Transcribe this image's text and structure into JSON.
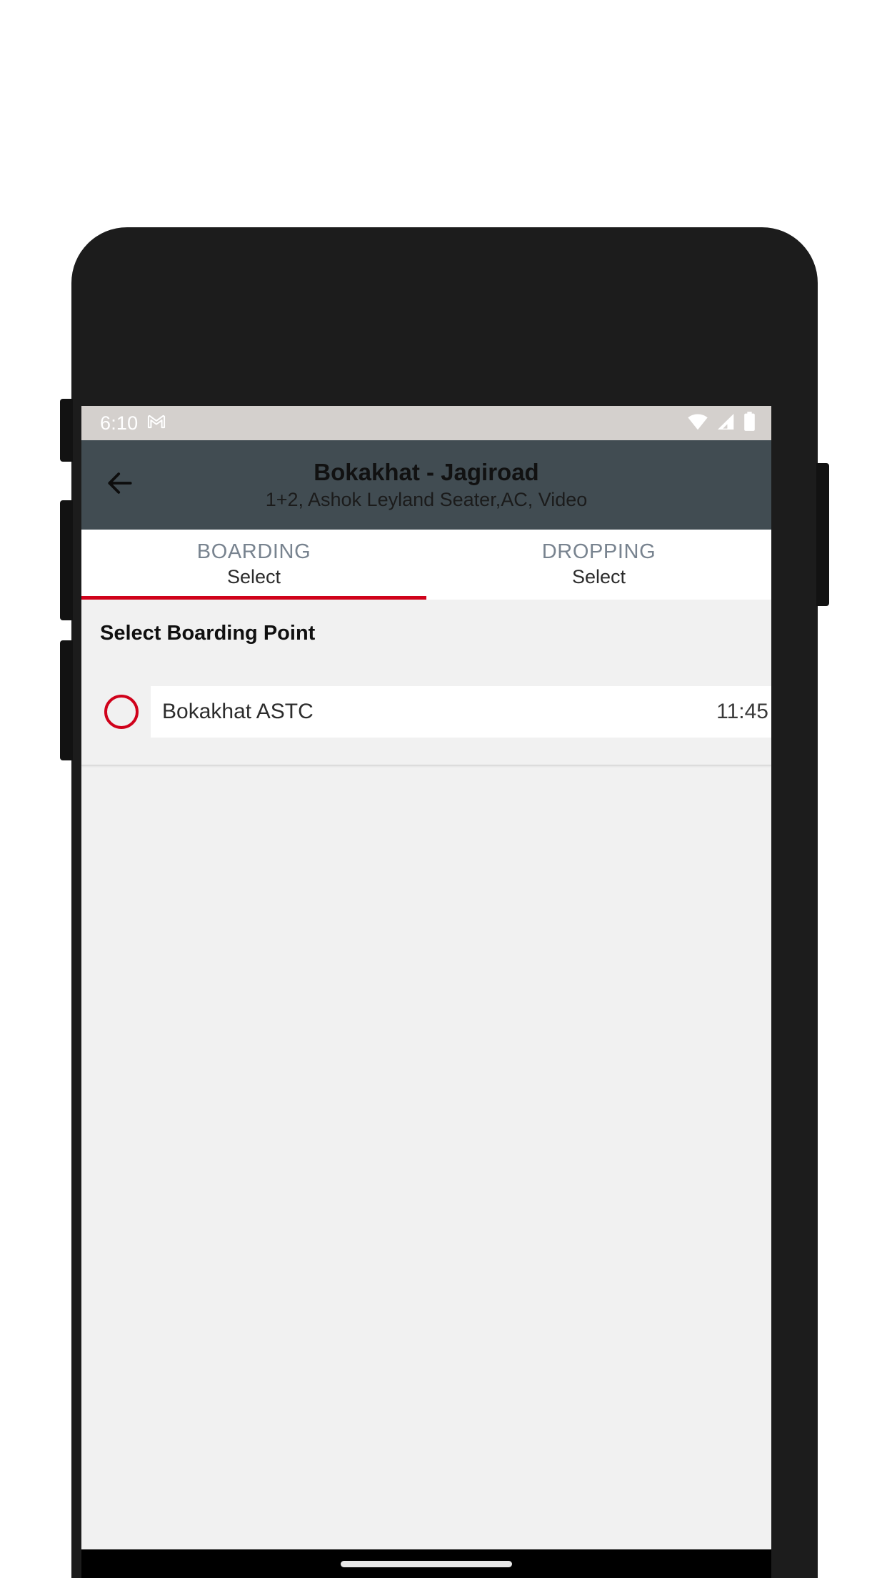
{
  "status_bar": {
    "time": "6:10",
    "notification_icon": "gmail-icon",
    "icons": [
      "wifi-icon",
      "cellular-signal-icon",
      "battery-icon"
    ]
  },
  "app_bar": {
    "back_icon": "back-arrow-icon",
    "title": "Bokakhat - Jagiroad",
    "subtitle": "1+2, Ashok Leyland Seater,AC, Video",
    "background_color": "#414c52"
  },
  "tabs": [
    {
      "label": "BOARDING",
      "value": "Select",
      "active": true
    },
    {
      "label": "DROPPING",
      "value": "Select",
      "active": false
    }
  ],
  "content": {
    "section_title": "Select Boarding Point",
    "points": [
      {
        "name": "Bokakhat ASTC",
        "time": "11:45",
        "selected": false
      }
    ]
  },
  "colors": {
    "accent": "#d0021b",
    "app_bar": "#414c52",
    "tab_label": "#78838f",
    "background": "#f1f1f1",
    "status_bar": "#d4d0cd"
  },
  "nav_bar": {
    "gesture_pill": "home-gesture-pill"
  }
}
